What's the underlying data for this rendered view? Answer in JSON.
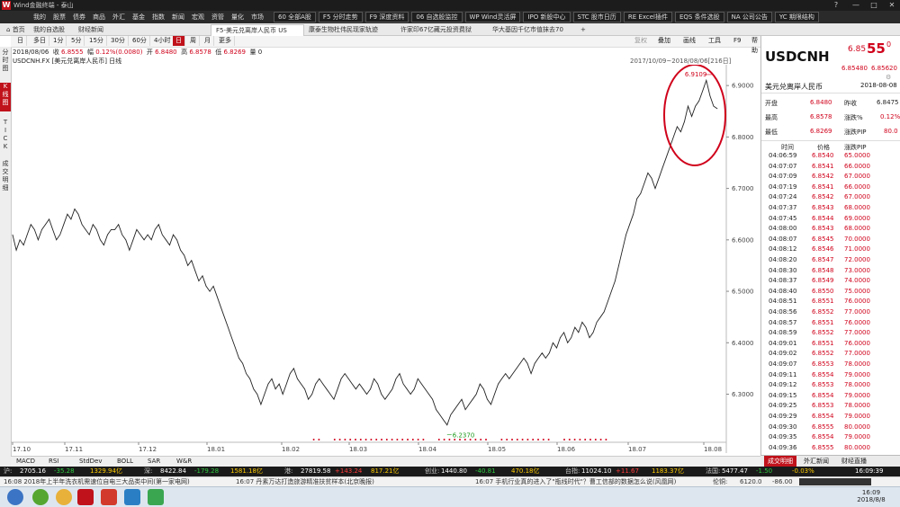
{
  "app": {
    "logo": "W",
    "title": "Wind金融终端 - 泰山"
  },
  "menu": [
    "我的",
    "股票",
    "债券",
    "商品",
    "外汇",
    "基金",
    "指数",
    "新闻",
    "宏观",
    "资管",
    "量化",
    "市场"
  ],
  "fn_buttons": [
    "60 全部A股",
    "F5 分时走势",
    "F9 深度资料",
    "06 自选股监控",
    "WP Wind灵活屏",
    "IPO 新股中心",
    "STC 股市日历",
    "RE Excel插件",
    "EQS 条件选股",
    "NA 公司公告",
    "YC 期限结构"
  ],
  "tabs": [
    "首页",
    "我的自选股",
    "财经新闻",
    "F5-美元兑离岸人民币 US",
    "康泰生物杜伟民...",
    "许家印67亿...",
    "华大基因..."
  ],
  "tabs_full": [
    "首页",
    "我的自选股",
    "财经新闻",
    "F5-美元兑离岸人民币 US",
    "康泰生物杜伟民现家轨迹",
    "许家印67亿藏元投资费狱",
    "华大基因千亿市值抹去70"
  ],
  "rail": [
    "分时图",
    "K线图",
    "TICK",
    "成交明细"
  ],
  "periods": [
    "日",
    "多日",
    "1分",
    "5分",
    "15分",
    "30分",
    "60分",
    "4小时",
    "日",
    "周",
    "月",
    "更多"
  ],
  "toolbar_right": [
    "复权",
    "叠加",
    "画线",
    "工具",
    "F9",
    "帮助"
  ],
  "info": {
    "date": "2018/08/06",
    "close_label": "收",
    "close": "6.8555",
    "change_label": "幅",
    "change": "0.12%(0.0080)",
    "open_label": "开",
    "open": "6.8480",
    "high_label": "高",
    "high": "6.8578",
    "low_label": "低",
    "low": "6.8269",
    "vol_label": "量",
    "vol": "0",
    "symbol_line": "USDCNH.FX [美元兑离岸人民币] 日线",
    "range": "2017/10/09~2018/08/06[216日]"
  },
  "chart_data": {
    "type": "line",
    "title": "USDCNH.FX [美元兑离岸人民币] 日线",
    "x_ticks": [
      "17.10",
      "17.11",
      "17.12",
      "18.01",
      "18.02",
      "18.03",
      "18.04",
      "18.05",
      "18.06",
      "18.07",
      "18.08"
    ],
    "y_ticks": [
      6.3,
      6.4,
      6.5,
      6.6,
      6.7,
      6.8,
      6.9
    ],
    "ylim": [
      6.21,
      6.93
    ],
    "annotations": [
      {
        "text": "6.9109",
        "value": 6.9109
      },
      {
        "text": "6.2370",
        "value": 6.237
      }
    ],
    "values": [
      6.61,
      6.58,
      6.6,
      6.59,
      6.61,
      6.63,
      6.62,
      6.6,
      6.62,
      6.63,
      6.64,
      6.62,
      6.6,
      6.61,
      6.63,
      6.65,
      6.64,
      6.66,
      6.65,
      6.63,
      6.62,
      6.61,
      6.63,
      6.62,
      6.6,
      6.59,
      6.61,
      6.62,
      6.62,
      6.63,
      6.61,
      6.6,
      6.58,
      6.6,
      6.62,
      6.61,
      6.6,
      6.61,
      6.6,
      6.62,
      6.63,
      6.61,
      6.6,
      6.59,
      6.61,
      6.6,
      6.58,
      6.57,
      6.55,
      6.56,
      6.54,
      6.52,
      6.53,
      6.51,
      6.5,
      6.51,
      6.49,
      6.47,
      6.45,
      6.43,
      6.41,
      6.39,
      6.37,
      6.36,
      6.34,
      6.33,
      6.31,
      6.3,
      6.28,
      6.3,
      6.32,
      6.33,
      6.31,
      6.32,
      6.3,
      6.32,
      6.34,
      6.35,
      6.33,
      6.32,
      6.31,
      6.29,
      6.3,
      6.32,
      6.33,
      6.32,
      6.31,
      6.3,
      6.29,
      6.31,
      6.33,
      6.34,
      6.33,
      6.32,
      6.31,
      6.32,
      6.31,
      6.3,
      6.31,
      6.33,
      6.32,
      6.3,
      6.29,
      6.3,
      6.31,
      6.33,
      6.34,
      6.32,
      6.31,
      6.3,
      6.31,
      6.33,
      6.32,
      6.31,
      6.3,
      6.29,
      6.27,
      6.26,
      6.25,
      6.24,
      6.26,
      6.27,
      6.28,
      6.29,
      6.27,
      6.28,
      6.29,
      6.3,
      6.32,
      6.31,
      6.29,
      6.28,
      6.3,
      6.32,
      6.33,
      6.34,
      6.33,
      6.34,
      6.35,
      6.36,
      6.37,
      6.36,
      6.34,
      6.36,
      6.37,
      6.38,
      6.37,
      6.38,
      6.4,
      6.39,
      6.41,
      6.42,
      6.4,
      6.41,
      6.43,
      6.42,
      6.44,
      6.43,
      6.41,
      6.42,
      6.44,
      6.45,
      6.46,
      6.48,
      6.5,
      6.52,
      6.55,
      6.58,
      6.61,
      6.63,
      6.65,
      6.68,
      6.69,
      6.71,
      6.73,
      6.72,
      6.7,
      6.72,
      6.74,
      6.76,
      6.78,
      6.8,
      6.82,
      6.81,
      6.83,
      6.86,
      6.84,
      6.86,
      6.87,
      6.89,
      6.91,
      6.88,
      6.86,
      6.855
    ],
    "highlight_circle": true
  },
  "bottom_tabs": [
    "MACD",
    "RSI",
    "StdDev",
    "BOLL",
    "SAR",
    "W&R"
  ],
  "quote": {
    "symbol": "USDCNH",
    "price_main": "6.85",
    "price_big": "55",
    "price_sup": "0",
    "bid": "6.85480",
    "ask": "6.85620",
    "name": "美元兑离岸人民币",
    "date": "2018-08-08",
    "rows": [
      [
        "开盘",
        "6.8480",
        "昨收",
        "6.8475"
      ],
      [
        "最高",
        "6.8578",
        "涨跌%",
        "0.12%"
      ],
      [
        "最低",
        "6.8269",
        "涨跌PIP",
        "80.0"
      ]
    ],
    "ticks_header": [
      "时间",
      "价格",
      "涨跌PIP"
    ],
    "ticks": [
      [
        "04:06:59",
        "6.8540",
        "65.0000"
      ],
      [
        "04:07:07",
        "6.8541",
        "66.0000"
      ],
      [
        "04:07:09",
        "6.8542",
        "67.0000"
      ],
      [
        "04:07:19",
        "6.8541",
        "66.0000"
      ],
      [
        "04:07:24",
        "6.8542",
        "67.0000"
      ],
      [
        "04:07:37",
        "6.8543",
        "68.0000"
      ],
      [
        "04:07:45",
        "6.8544",
        "69.0000"
      ],
      [
        "04:08:00",
        "6.8543",
        "68.0000"
      ],
      [
        "04:08:07",
        "6.8545",
        "70.0000"
      ],
      [
        "04:08:12",
        "6.8546",
        "71.0000"
      ],
      [
        "04:08:20",
        "6.8547",
        "72.0000"
      ],
      [
        "04:08:30",
        "6.8548",
        "73.0000"
      ],
      [
        "04:08:37",
        "6.8549",
        "74.0000"
      ],
      [
        "04:08:40",
        "6.8550",
        "75.0000"
      ],
      [
        "04:08:51",
        "6.8551",
        "76.0000"
      ],
      [
        "04:08:56",
        "6.8552",
        "77.0000"
      ],
      [
        "04:08:57",
        "6.8551",
        "76.0000"
      ],
      [
        "04:08:59",
        "6.8552",
        "77.0000"
      ],
      [
        "04:09:01",
        "6.8551",
        "76.0000"
      ],
      [
        "04:09:02",
        "6.8552",
        "77.0000"
      ],
      [
        "04:09:07",
        "6.8553",
        "78.0000"
      ],
      [
        "04:09:11",
        "6.8554",
        "79.0000"
      ],
      [
        "04:09:12",
        "6.8553",
        "78.0000"
      ],
      [
        "04:09:15",
        "6.8554",
        "79.0000"
      ],
      [
        "04:09:25",
        "6.8553",
        "78.0000"
      ],
      [
        "04:09:29",
        "6.8554",
        "79.0000"
      ],
      [
        "04:09:30",
        "6.8555",
        "80.0000"
      ],
      [
        "04:09:35",
        "6.8554",
        "79.0000"
      ],
      [
        "04:09:36",
        "6.8555",
        "80.0000"
      ]
    ],
    "footer": [
      "成交明细",
      "外汇新闻",
      "财经直播"
    ]
  },
  "indexbar": [
    {
      "label": "沪:",
      "v1": "2705.16",
      "v2": "-35.28",
      "v3": "1329.94亿"
    },
    {
      "label": "深:",
      "v1": "8422.84",
      "v2": "-179.28",
      "v3": "1581.18亿"
    },
    {
      "label": "港:",
      "v1": "27819.58",
      "v2": "+143.24",
      "v3": "817.21亿"
    },
    {
      "label": "创业:",
      "v1": "1440.80",
      "v2": "-40.81",
      "v3": "470.18亿"
    },
    {
      "label": "台指:",
      "v1": "11024.10",
      "v2": "+11.67",
      "v3": "1183.37亿"
    },
    {
      "label": "法国:",
      "v1": "5477.47",
      "v2": "-1.50",
      "v3": "-0.03%"
    }
  ],
  "clock_top": "16:09:39",
  "news": [
    "16:08  2018年上半年洗衣机需速位自电三大品类中间(第一家电网)",
    "16:07  丹素万达打造旅游精准扶贫样本(北京晚报)",
    "16:07  手机行业真的进入了\"瓶线时代\"？曹工信部的数据怎么说(风凰网)",
    "伦铜:",
    "6120.0",
    "-86.00"
  ],
  "taskbar": {
    "time": "16:09",
    "date": "2018/8/8"
  },
  "colors": {
    "accent": "#c0121b",
    "up": "#d0021b",
    "down": "#1a9a1a",
    "circle": "#d0021b"
  }
}
